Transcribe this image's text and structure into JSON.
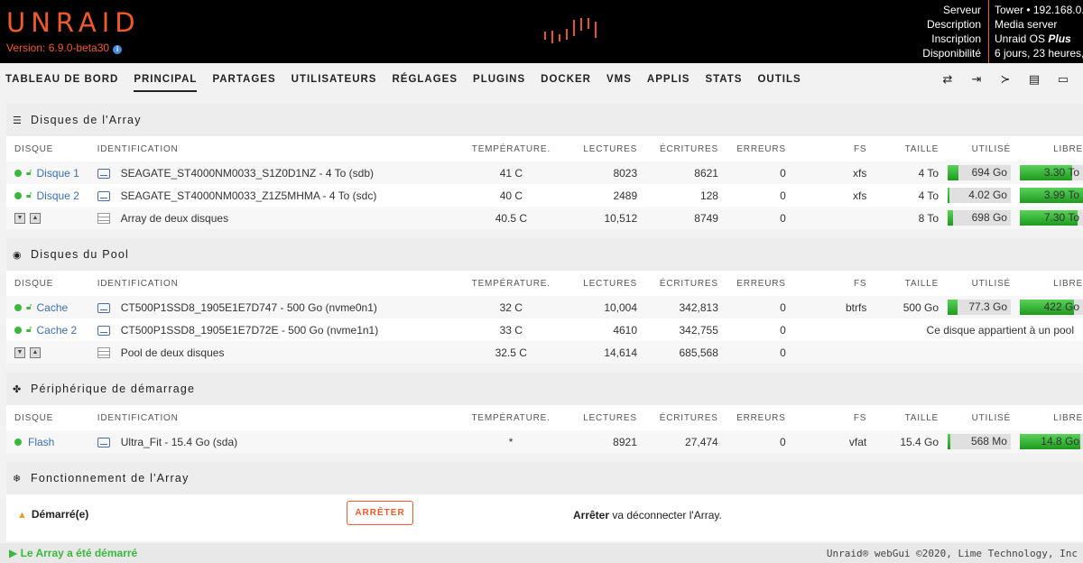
{
  "header": {
    "logo": "UNRAID",
    "version": "Version: 6.9.0-beta30",
    "server_info": {
      "keys": [
        "Serveur",
        "Description",
        "Inscription",
        "Disponibilité"
      ],
      "values": [
        "Tower • 192.168.0.",
        "Media server",
        "Unraid OS Plus",
        "6 jours, 23 heures,"
      ]
    }
  },
  "nav": {
    "tabs": [
      "TABLEAU DE BORD",
      "PRINCIPAL",
      "PARTAGES",
      "UTILISATEURS",
      "RÉGLAGES",
      "PLUGINS",
      "DOCKER",
      "VMS",
      "APPLIS",
      "STATS",
      "OUTILS"
    ],
    "active": "PRINCIPAL",
    "icons": [
      "switch-icon",
      "logout-icon",
      "terminal-icon",
      "notes-icon",
      "monitor-icon"
    ]
  },
  "columns": {
    "disk": "DISQUE",
    "id": "IDENTIFICATION",
    "temp": "TEMPÉRATURE.",
    "reads": "LECTURES",
    "writes": "ÉCRITURES",
    "errors": "ERREURS",
    "fs": "FS",
    "size": "TAILLE",
    "used": "UTILISÉ",
    "free": "LIBRE"
  },
  "array": {
    "title": "Disques de l'Array",
    "rows": [
      {
        "name": "Disque 1",
        "id": "SEAGATE_ST4000NM0033_S1Z0D1NZ - 4 To (sdb)",
        "temp": "41 C",
        "reads": "8023",
        "writes": "8621",
        "errors": "0",
        "fs": "xfs",
        "size": "4 To",
        "used": "694 Go",
        "used_pct": 0.17,
        "free": "3.30 To",
        "free_pct": 0.83
      },
      {
        "name": "Disque 2",
        "id": "SEAGATE_ST4000NM0033_Z1Z5MHMA - 4 To (sdc)",
        "temp": "40 C",
        "reads": "2489",
        "writes": "128",
        "errors": "0",
        "fs": "xfs",
        "size": "4 To",
        "used": "4.02 Go",
        "used_pct": 0.001,
        "free": "3.99 To",
        "free_pct": 1.0
      }
    ],
    "summary": {
      "id": "Array de deux disques",
      "temp": "40.5 C",
      "reads": "10,512",
      "writes": "8749",
      "errors": "0",
      "size": "8 To",
      "used": "698 Go",
      "used_pct": 0.09,
      "free": "7.30 To",
      "free_pct": 0.91
    }
  },
  "pool": {
    "title": "Disques du Pool",
    "rows": [
      {
        "name": "Cache",
        "id": "CT500P1SSD8_1905E1E7D747 - 500 Go (nvme0n1)",
        "temp": "32 C",
        "reads": "10,004",
        "writes": "342,813",
        "errors": "0",
        "fs": "btrfs",
        "size": "500 Go",
        "used": "77.3 Go",
        "used_pct": 0.15,
        "free": "422 Go",
        "free_pct": 0.85
      },
      {
        "name": "Cache 2",
        "id": "CT500P1SSD8_1905E1E7D72E - 500 Go (nvme1n1)",
        "temp": "33 C",
        "reads": "4610",
        "writes": "342,755",
        "errors": "0",
        "note": "Ce disque appartient à un pool"
      }
    ],
    "summary": {
      "id": "Pool de deux disques",
      "temp": "32.5 C",
      "reads": "14,614",
      "writes": "685,568",
      "errors": "0"
    }
  },
  "boot": {
    "title": "Périphérique de démarrage",
    "row": {
      "name": "Flash",
      "id": "Ultra_Fit - 15.4 Go (sda)",
      "temp": "*",
      "reads": "8921",
      "writes": "27,474",
      "errors": "0",
      "fs": "vfat",
      "size": "15.4 Go",
      "used": "568 Mo",
      "used_pct": 0.04,
      "free": "14.8 Go",
      "free_pct": 0.96
    }
  },
  "operation": {
    "title": "Fonctionnement de l'Array",
    "status": "Démarré(e)",
    "stop_button": "ARRÊTER",
    "stop_label": "Arrêter",
    "stop_desc": "va déconnecter l'Array."
  },
  "footer": {
    "status": "Le Array a été démarré",
    "copyright": "Unraid® webGui ©2020, Lime Technology, Inc"
  },
  "colors": {
    "accent": "#f15a2c",
    "green": "#3ab83a",
    "link": "#3c6fb5"
  }
}
